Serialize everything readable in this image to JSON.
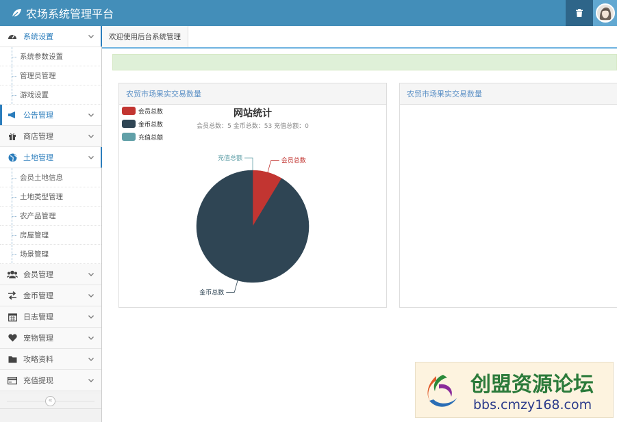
{
  "app": {
    "title": "农场系统管理平台"
  },
  "sidebar": {
    "groups": [
      {
        "label": "系统设置",
        "icon": "dashboard-icon",
        "state": "open",
        "children": [
          "系统参数设置",
          "管理员管理",
          "游戏设置"
        ]
      },
      {
        "label": "公告管理",
        "icon": "bullhorn-icon",
        "state": "highlight",
        "children": []
      },
      {
        "label": "商店管理",
        "icon": "gift-icon",
        "state": "normal",
        "children": []
      },
      {
        "label": "土地管理",
        "icon": "globe-icon",
        "state": "open",
        "children": [
          "会员土地信息",
          "土地类型管理",
          "农产品管理",
          "房屋管理",
          "场景管理"
        ]
      },
      {
        "label": "会员管理",
        "icon": "users-icon",
        "state": "normal",
        "children": []
      },
      {
        "label": "金币管理",
        "icon": "exchange-icon",
        "state": "normal",
        "children": []
      },
      {
        "label": "日志管理",
        "icon": "calendar-icon",
        "state": "normal",
        "children": []
      },
      {
        "label": "宠物管理",
        "icon": "heart-icon",
        "state": "normal",
        "children": []
      },
      {
        "label": "攻略资料",
        "icon": "folder-icon",
        "state": "normal",
        "children": []
      },
      {
        "label": "充值提现",
        "icon": "credit-card-icon",
        "state": "normal",
        "children": []
      }
    ],
    "collapse_glyph": "«"
  },
  "tabs": {
    "active": "欢迎使用后台系统管理"
  },
  "panels": [
    {
      "title": "农贸市场果实交易数量"
    },
    {
      "title": "农贸市场果实交易数量"
    }
  ],
  "chart_data": {
    "type": "pie",
    "title": "网站统计",
    "subtitle": "会员总数：5 金币总数：53 充值总额：0",
    "legend_position": "top-left",
    "slices": [
      {
        "name": "会员总数",
        "value": 5,
        "color": "#c23531"
      },
      {
        "name": "金币总数",
        "value": 53,
        "color": "#2f4554"
      },
      {
        "name": "充值总额",
        "value": 0,
        "color": "#61a0a8"
      }
    ]
  },
  "watermark": {
    "cn_text": "创盟资源论坛",
    "url": "bbs.cmzy168.com"
  }
}
